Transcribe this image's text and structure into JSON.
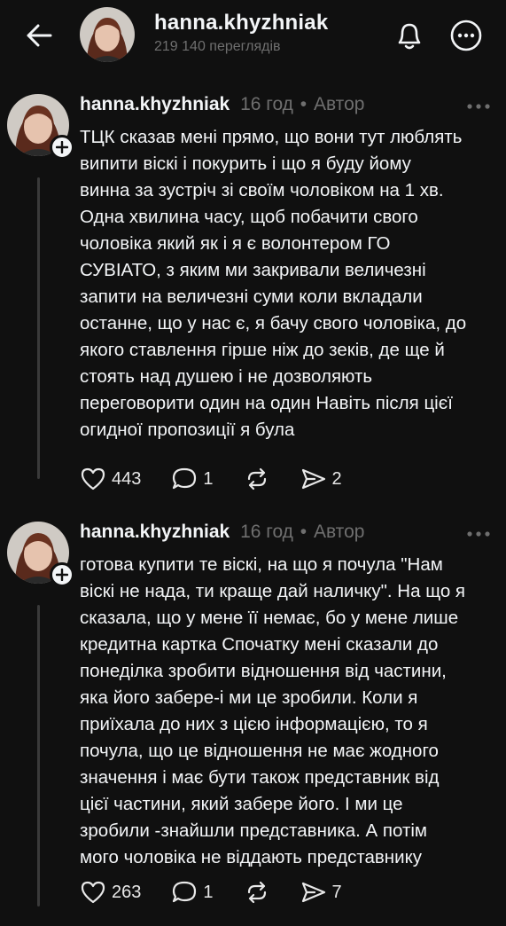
{
  "header": {
    "username": "hanna.khyzhniak",
    "views": "219 140 переглядів",
    "icons": {
      "back": "arrow-left-icon",
      "bell": "bell-icon",
      "more": "more-circle-icon"
    }
  },
  "posts": [
    {
      "username": "hanna.khyzhniak",
      "time": "16 год",
      "separator": "•",
      "author_tag": "Автор",
      "lines": [
        "ТЦК сказав мені прямо, що вони тут люблять",
        "випити віскі і покурить і що я буду йому",
        "винна за зустріч зі своїм чоловіком на 1 хв.",
        "Одна хвилина часу, щоб побачити свого",
        "чоловіка який як і я є волонтером ГО",
        "СУВІАТО, з яким ми закривали величезні",
        "запити на величезні суми коли вкладали",
        "останне, що у нас є, я бачу свого чоловіка, до",
        "якого ставлення гірше ніж до зеків, де ще й",
        "стоять над душею і не дозволяють",
        "переговорити один на один Навіть після цієї",
        "огидної пропозиції я була"
      ],
      "likes": "443",
      "replies": "1",
      "shares": "2"
    },
    {
      "username": "hanna.khyzhniak",
      "time": "16 год",
      "separator": "•",
      "author_tag": "Автор",
      "lines": [
        "готова купити те віскі, на що я почула \"Нам",
        "віскі не нада, ти краще дай наличку\". На що я",
        "сказала, що у мене її немає, бо у мене лише",
        "кредитна картка Спочатку мені сказали до",
        "понеділка зробити відношення від частини,",
        "яка його забере-і ми це зробили. Коли я",
        "приїхала до них з цією інформацією, то я",
        "почула, що це відношення не має жодного",
        "значення і має бути також представник від",
        "цієї частини, який забере його. І ми це",
        "зробили -знайшли представника. А потім",
        "мого чоловіка не віддають представнику"
      ],
      "likes": "263",
      "replies": "1",
      "shares": "7"
    }
  ],
  "colors": {
    "background": "#101010",
    "text": "#f3f5f7",
    "muted": "#6f6f6f",
    "thread_line": "#3a3a3a"
  }
}
